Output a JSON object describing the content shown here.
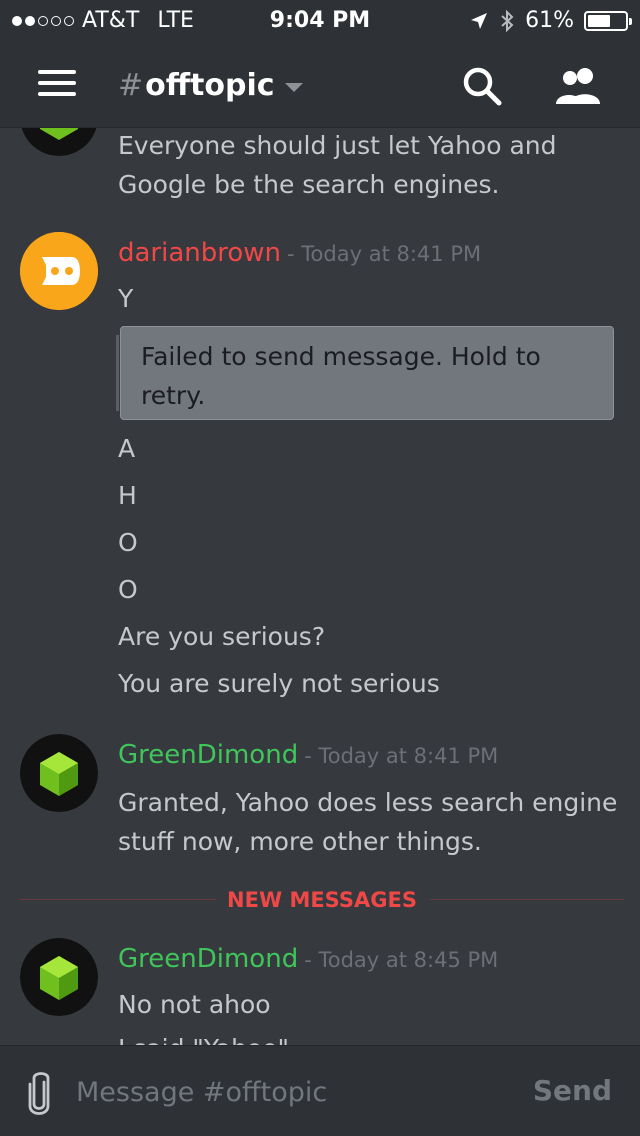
{
  "status_bar": {
    "carrier": "AT&T",
    "network": "LTE",
    "time": "9:04 PM",
    "battery": "61%",
    "battery_level": 0.61,
    "signal_bars_filled": 2,
    "signal_bars_total": 5
  },
  "header": {
    "channel_hash": "#",
    "channel_name": "offtopic"
  },
  "messages": [
    {
      "author": "",
      "author_color": "#3fc55a",
      "lines": [
        "Everyone should just let Yahoo and Google be the search engines."
      ]
    },
    {
      "author": "darianbrown",
      "author_color": "#f04747",
      "timestamp": "- Today at 8:41 PM",
      "failed_line": "Y",
      "failed_notice": "Failed to send message. Hold to retry.",
      "lines": [
        "A",
        "H",
        "O",
        "O",
        "Are you serious?",
        "You are surely not serious"
      ]
    },
    {
      "author": "GreenDimond",
      "author_color": "#3fc55a",
      "timestamp": "- Today at 8:41 PM",
      "lines": [
        "Granted, Yahoo does less search engine stuff now, more other things."
      ]
    },
    {
      "author": "GreenDimond",
      "author_color": "#3fc55a",
      "timestamp": "- Today at 8:45 PM",
      "lines": [
        "No not ahoo",
        "I said \"Yahoo\""
      ]
    }
  ],
  "new_messages_label": "NEW MESSAGES",
  "composer": {
    "placeholder": "Message #offtopic",
    "send_label": "Send"
  },
  "colors": {
    "background": "#36393e",
    "bars": "#2e3136",
    "accent_red": "#f04747",
    "accent_green": "#3fc55a"
  }
}
